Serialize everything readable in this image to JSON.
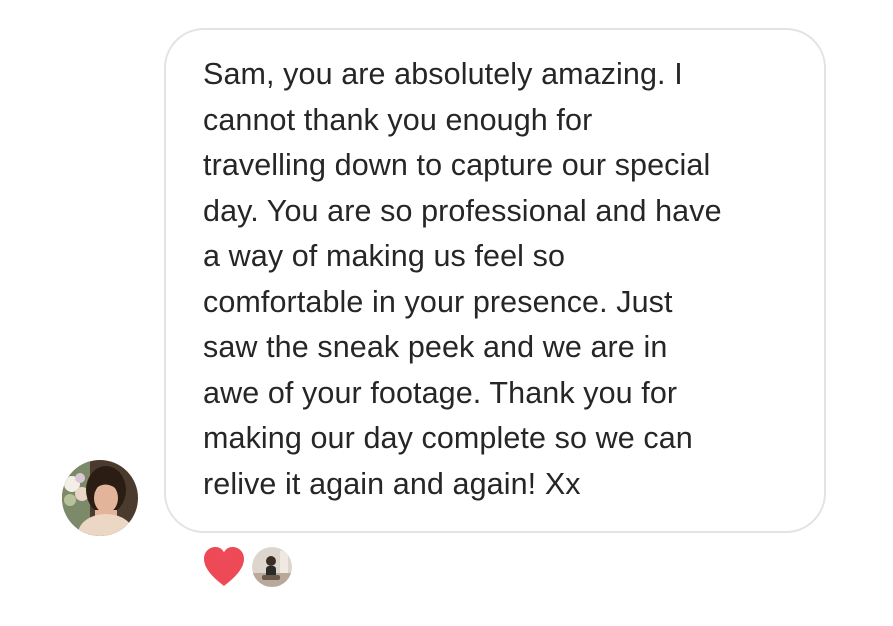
{
  "message": {
    "lines": [
      "Sam, you are absolutely amazing. I",
      "cannot thank you enough for",
      "travelling down to capture our special",
      "day. You are so professional and have",
      "a way of making us feel so",
      "comfortable in your presence. Just",
      "saw the sneak peek and we are in",
      "awe of your footage. Thank you for",
      "making our day complete so we can",
      "relive it again and again! Xx"
    ]
  },
  "sender": {
    "avatar_icon": "profile-photo"
  },
  "reactions": [
    {
      "icon": "heart-icon",
      "color": "#ed4956"
    },
    {
      "icon": "reactor-profile-photo"
    }
  ],
  "colors": {
    "text": "#262626",
    "bubble_border": "#e3e3e3",
    "heart": "#ed4956",
    "background": "#ffffff"
  }
}
